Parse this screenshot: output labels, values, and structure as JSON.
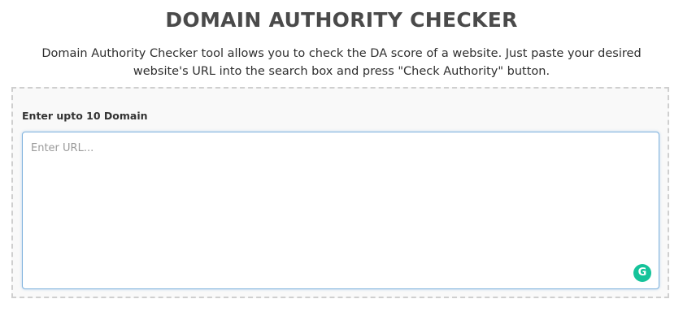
{
  "header": {
    "title": "DOMAIN AUTHORITY CHECKER",
    "description": "Domain Authority Checker tool allows you to check the DA score of a website. Just paste your desired website's URL into the search box and press \"Check Authority\" button."
  },
  "form": {
    "label": "Enter upto 10 Domain",
    "input_placeholder": "Enter URL...",
    "input_value": ""
  },
  "icons": {
    "grammarly": {
      "name": "grammarly-icon",
      "glyph": "G",
      "color": "#15c39a"
    }
  },
  "colors": {
    "input_focus_border": "#7fb2dd",
    "panel_background": "#f9f9f9",
    "panel_border": "#cfcfcf"
  }
}
